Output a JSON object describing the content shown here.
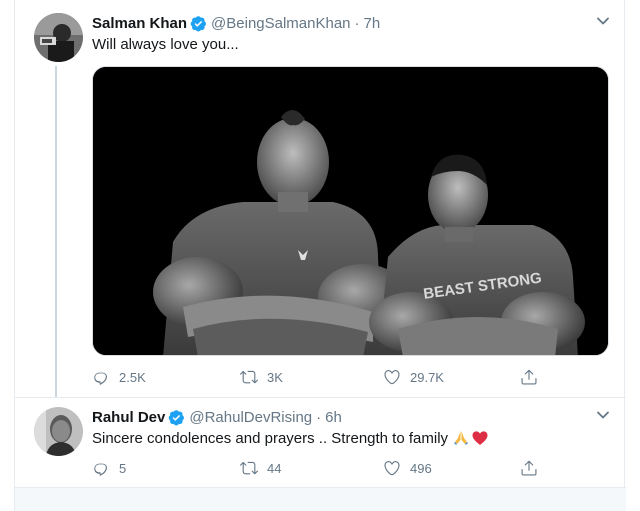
{
  "tweets": [
    {
      "name": "Salman Khan",
      "handle": "@BeingSalmanKhan",
      "separator": "·",
      "time": "7h",
      "text": "Will always love you...",
      "replies": "2.5K",
      "retweets": "3K",
      "likes": "29.7K",
      "avatar_icon": "avatar-photo-icon",
      "media_printed_text": "BEAST STRONG"
    },
    {
      "name": "Rahul Dev",
      "handle": "@RahulDevRising",
      "separator": "·",
      "time": "6h",
      "text": "Sincere condolences and prayers .. Strength to family",
      "replies": "5",
      "retweets": "44",
      "likes": "496",
      "emojis": [
        "folded-hands-icon",
        "red-heart-icon"
      ],
      "avatar_icon": "avatar-photo-icon"
    }
  ],
  "colors": {
    "verified_blue": "#1da1f2",
    "secondary_text": "#657786",
    "border": "#e6ecf0"
  }
}
